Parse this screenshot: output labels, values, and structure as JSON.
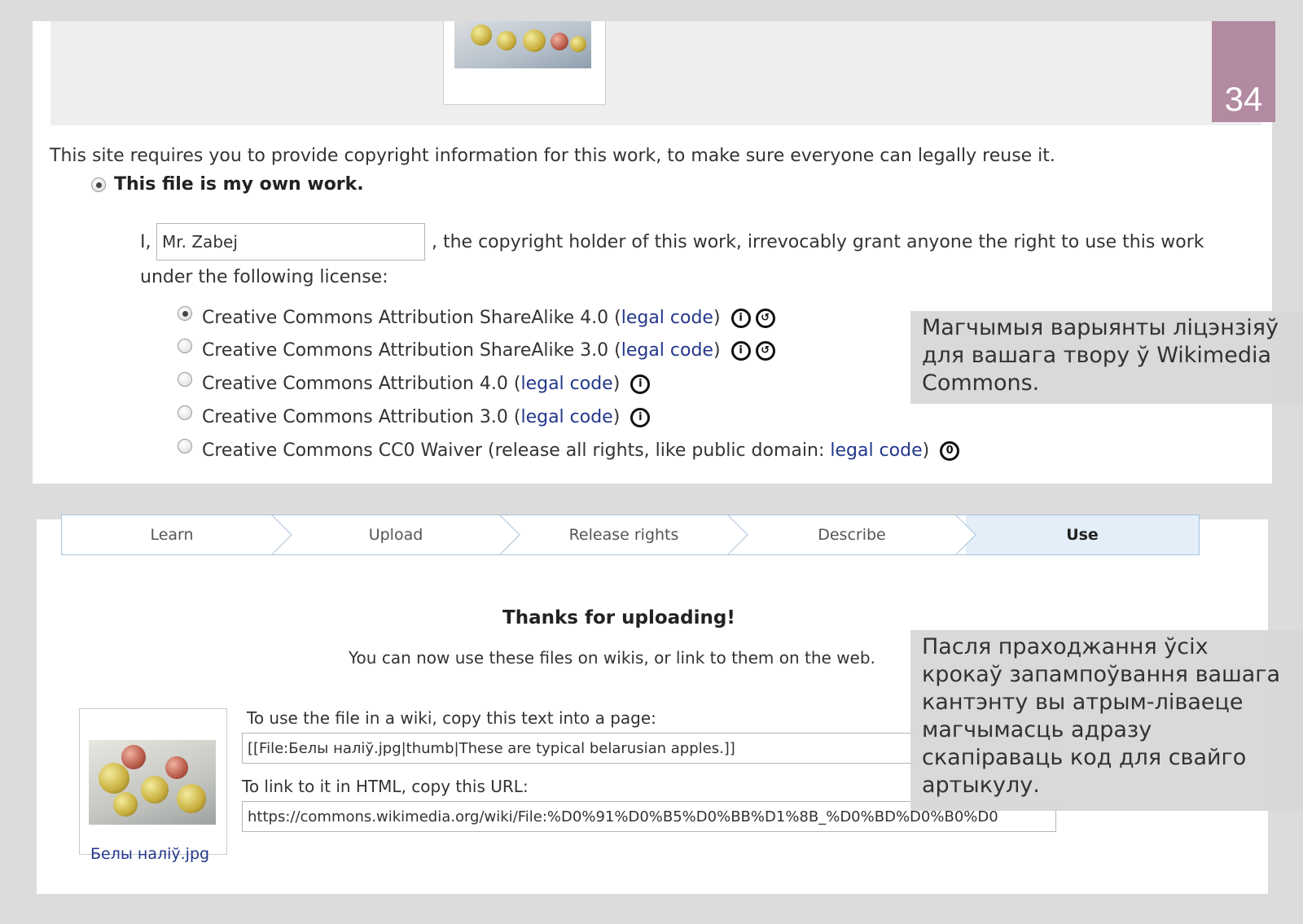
{
  "page_number": "34",
  "top": {
    "intro": "This site requires you to provide copyright information for this work, to make sure everyone can legally reuse it.",
    "own_work_label": "This file is my own work.",
    "grant_prefix": "I,",
    "author_value": "Mr. Zabej",
    "grant_suffix": ", the copyright holder of this work, irrevocably grant anyone the right to use this work",
    "grant_line2": "under the following license:",
    "licenses": [
      {
        "label": "Creative Commons Attribution ShareAlike 4.0 (",
        "link": "legal code",
        "close": ")",
        "checked": true,
        "icons": [
          "by-icon",
          "sa-icon"
        ]
      },
      {
        "label": "Creative Commons Attribution ShareAlike 3.0 (",
        "link": "legal code",
        "close": ")",
        "checked": false,
        "icons": [
          "by-icon",
          "sa-icon"
        ]
      },
      {
        "label": "Creative Commons Attribution 4.0 (",
        "link": "legal code",
        "close": ")",
        "checked": false,
        "icons": [
          "by-icon"
        ]
      },
      {
        "label": "Creative Commons Attribution 3.0 (",
        "link": "legal code",
        "close": ")",
        "checked": false,
        "icons": [
          "by-icon"
        ]
      },
      {
        "label": "Creative Commons CC0 Waiver (release all rights, like public domain: ",
        "link": "legal code",
        "close": ")",
        "checked": false,
        "icons": [
          "zero-icon"
        ]
      }
    ],
    "callout": "Магчымыя варыянты ліцэнзіяў для вашага твору ў Wikimedia Commons."
  },
  "bottom": {
    "steps": [
      "Learn",
      "Upload",
      "Release rights",
      "Describe",
      "Use"
    ],
    "thanks_title": "Thanks for uploading!",
    "thanks_sub": "You can now use these files on wikis, or link to them on the web.",
    "wiki_label": "To use the file in a wiki, copy this text into a page:",
    "wiki_value": "[[File:Белы наліў.jpg|thumb|These are typical belarusian apples.]]",
    "html_label": "To link to it in HTML, copy this URL:",
    "html_value": "https://commons.wikimedia.org/wiki/File:%D0%91%D0%B5%D0%BB%D1%8B_%D0%BD%D0%B0%D0",
    "file_caption": "Белы наліў.jpg",
    "callout": "Пасля праходжання ўсіх крокаў запампоўвання вашага кантэнту вы атрым-ліваеце магчымасць адразу скапіраваць код для свайго артыкулу."
  },
  "colors": {
    "badge": "#b28aa1",
    "link": "#23378a",
    "step_active": "#e3eef8"
  }
}
